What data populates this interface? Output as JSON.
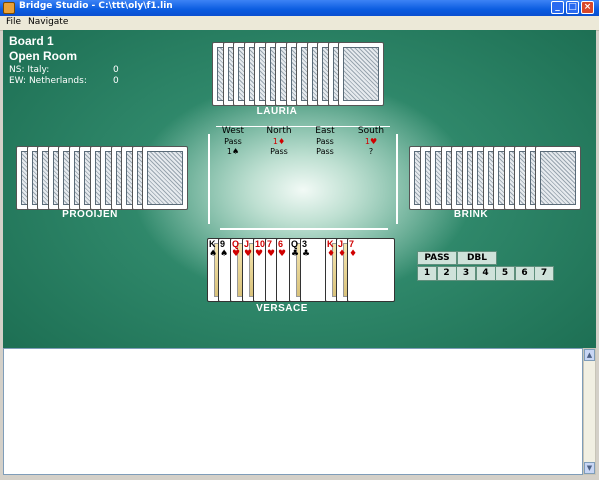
{
  "window": {
    "title": "Bridge Studio - C:\\ttt\\oly\\f1.lin",
    "minimize_glyph": "_",
    "maximize_glyph": "□",
    "close_glyph": "×"
  },
  "menu": {
    "file": "File",
    "navigate": "Navigate"
  },
  "info": {
    "board": "Board 1",
    "room": "Open Room",
    "ns_team": "NS:  Italy:",
    "ns_score": "0",
    "ew_team": "EW:  Netherlands:",
    "ew_score": "0"
  },
  "players": {
    "north": "LAURIA",
    "west": "PROOIJEN",
    "east": "BRINK",
    "south": "VERSACE"
  },
  "auction": {
    "headers": [
      "West",
      "North",
      "East",
      "South"
    ],
    "rows": [
      [
        {
          "bid": "Pass"
        },
        {
          "bid": "1♦",
          "red": true
        },
        {
          "bid": "Pass"
        },
        {
          "bid": "1♥",
          "red": true
        }
      ],
      [
        {
          "bid": "1♠"
        },
        {
          "bid": "Pass"
        },
        {
          "bid": "Pass"
        },
        {
          "bid": "?"
        }
      ]
    ]
  },
  "south_hand": [
    {
      "rank": "K",
      "suit": "♠",
      "color": "black",
      "face": true
    },
    {
      "rank": "9",
      "suit": "♠",
      "color": "black"
    },
    {
      "rank": "Q",
      "suit": "♥",
      "color": "red",
      "face": true
    },
    {
      "rank": "J",
      "suit": "♥",
      "color": "red",
      "face": true
    },
    {
      "rank": "10",
      "suit": "♥",
      "color": "red"
    },
    {
      "rank": "7",
      "suit": "♥",
      "color": "red"
    },
    {
      "rank": "6",
      "suit": "♥",
      "color": "red"
    },
    {
      "rank": "Q",
      "suit": "♣",
      "color": "black",
      "face": true
    },
    {
      "rank": "3",
      "suit": "♣",
      "color": "black"
    },
    {
      "rank": "K",
      "suit": "♦",
      "color": "red",
      "face": true
    },
    {
      "rank": "J",
      "suit": "♦",
      "color": "red",
      "face": true
    },
    {
      "rank": "7",
      "suit": "♦",
      "color": "red"
    }
  ],
  "bidding_box": {
    "pass": "PASS",
    "dbl": "DBL",
    "levels": [
      "1",
      "2",
      "3",
      "4",
      "5",
      "6",
      "7"
    ]
  },
  "scroll": {
    "up": "▲",
    "down": "▼"
  },
  "colors": {
    "felt": "#16654a",
    "titlebar": "#0a5ce0",
    "red_suit": "#d00000"
  }
}
